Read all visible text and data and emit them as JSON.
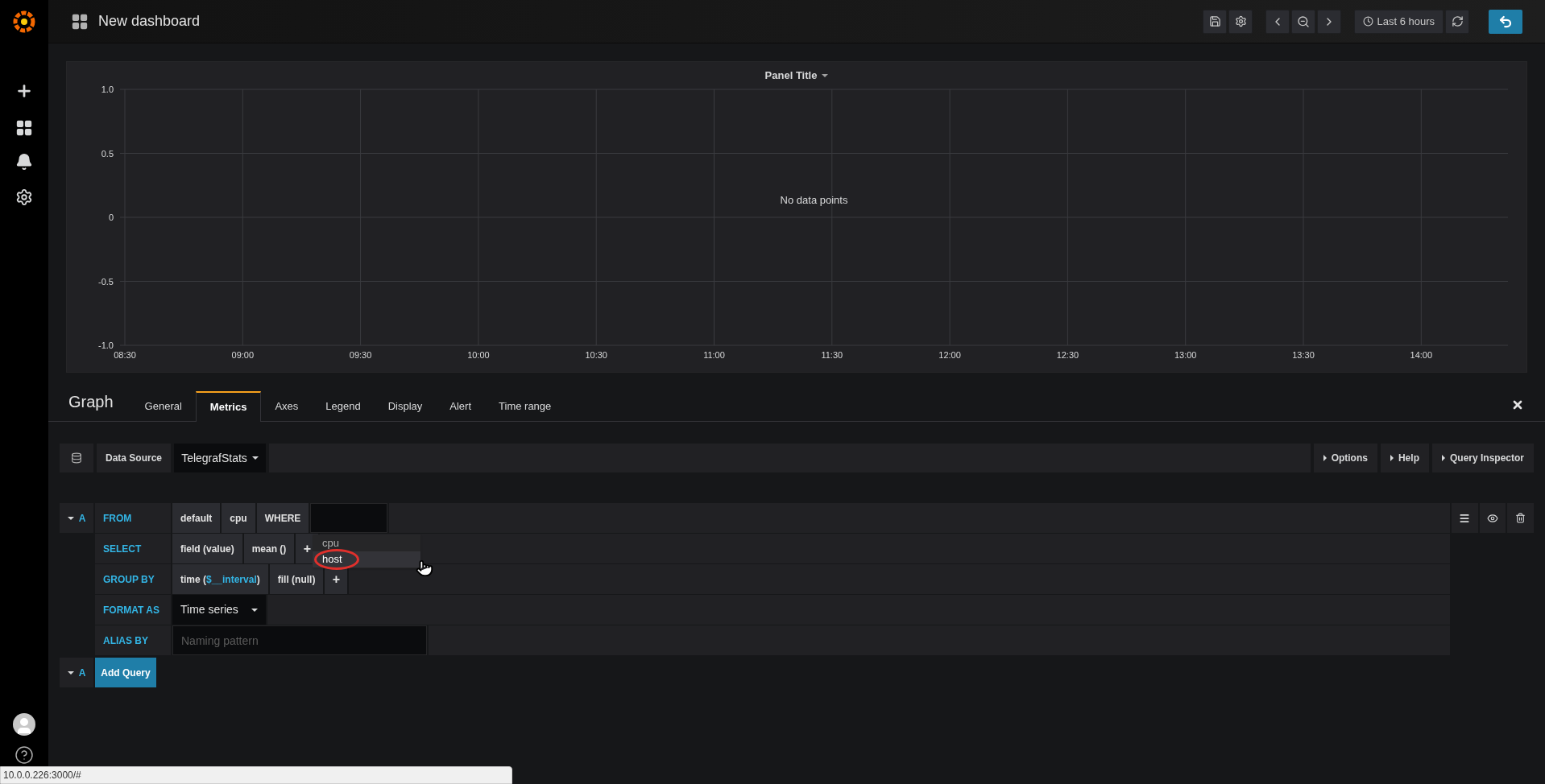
{
  "top_bar": {
    "title": "New dashboard",
    "time_range": "Last 6 hours"
  },
  "panel": {
    "title": "Panel Title",
    "message": "No data points",
    "chart_data": {
      "type": "line",
      "grid": true,
      "ylim": [
        -1,
        1
      ],
      "yticks": [
        {
          "value": 1,
          "label": "1.0"
        },
        {
          "value": 0.5,
          "label": "0.5"
        },
        {
          "value": 0,
          "label": "0"
        },
        {
          "value": -0.5,
          "label": "-0.5"
        },
        {
          "value": -1,
          "label": "-1.0"
        }
      ],
      "categories": [
        "08:30",
        "09:00",
        "09:30",
        "10:00",
        "10:30",
        "11:00",
        "11:30",
        "12:00",
        "12:30",
        "13:00",
        "13:30",
        "14:00"
      ]
    }
  },
  "editor": {
    "title": "Graph",
    "tabs": [
      {
        "label": "General",
        "selected": false
      },
      {
        "label": "Metrics",
        "selected": true
      },
      {
        "label": "Axes",
        "selected": false
      },
      {
        "label": "Legend",
        "selected": false
      },
      {
        "label": "Display",
        "selected": false
      },
      {
        "label": "Alert",
        "selected": false
      },
      {
        "label": "Time range",
        "selected": false
      }
    ]
  },
  "data_source": {
    "label": "Data Source",
    "value": "TelegrafStats",
    "buttons": [
      "Options",
      "Help",
      "Query Inspector"
    ]
  },
  "query": {
    "ref": "A",
    "rows": [
      {
        "label": "FROM",
        "parts": [
          {
            "kind": "segment",
            "text": "default"
          },
          {
            "kind": "segment",
            "text": "cpu"
          },
          {
            "kind": "keyword",
            "text": "WHERE"
          },
          {
            "kind": "input"
          }
        ]
      },
      {
        "label": "SELECT",
        "parts": [
          {
            "kind": "segment",
            "text": "field (value)"
          },
          {
            "kind": "segment",
            "text": "mean ()"
          },
          {
            "kind": "plus",
            "text": "+"
          }
        ]
      },
      {
        "label": "GROUP BY",
        "parts": [
          {
            "kind": "segment",
            "text": "time (",
            "variable": "$__interval",
            "suffix": ")"
          },
          {
            "kind": "segment",
            "text": "fill (null)"
          },
          {
            "kind": "plus",
            "text": "+"
          }
        ]
      },
      {
        "label": "FORMAT AS",
        "parts": [
          {
            "kind": "select",
            "text": "Time series"
          }
        ]
      },
      {
        "label": "ALIAS BY",
        "parts": [
          {
            "kind": "text-input",
            "placeholder": "Naming pattern"
          }
        ]
      }
    ],
    "dropdown": [
      {
        "text": "cpu",
        "selected": false
      },
      {
        "text": "host",
        "selected": true
      }
    ]
  },
  "add_query": {
    "ref": "A",
    "button": "Add Query"
  },
  "status_bar": {
    "url": "10.0.0.226:3000/#"
  }
}
